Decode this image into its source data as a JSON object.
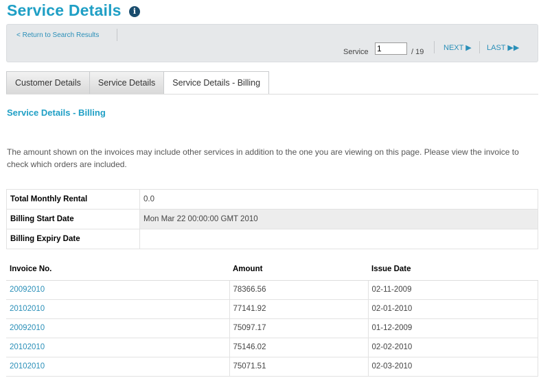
{
  "page": {
    "title": "Service Details",
    "info_icon": "info-icon"
  },
  "toolbar": {
    "return_link": "< Return to Search Results",
    "service_label": "Service",
    "service_value": "1",
    "service_total": "/ 19",
    "next_label": "NEXT ▶",
    "last_label": "LAST ▶▶"
  },
  "tabs": [
    {
      "label": "Customer Details",
      "active": false
    },
    {
      "label": "Service Details",
      "active": false
    },
    {
      "label": "Service Details - Billing",
      "active": true
    }
  ],
  "section": {
    "heading": "Service Details - Billing",
    "notice": "The amount shown on the invoices may include other services in addition to the one you are viewing on this page. Please view the invoice to check which orders are included."
  },
  "summary": [
    {
      "label": "Total Monthly Rental",
      "value": "0.0"
    },
    {
      "label": "Billing Start Date",
      "value": "Mon Mar 22 00:00:00 GMT 2010"
    },
    {
      "label": "Billing Expiry Date",
      "value": ""
    }
  ],
  "invoices": {
    "headers": [
      "Invoice No.",
      "Amount",
      "Issue Date"
    ],
    "rows": [
      {
        "invoice": "20092010",
        "amount": "78366.56",
        "date": "02-11-2009"
      },
      {
        "invoice": "20102010",
        "amount": "77141.92",
        "date": "02-01-2010"
      },
      {
        "invoice": "20092010",
        "amount": "75097.17",
        "date": "01-12-2009"
      },
      {
        "invoice": "20102010",
        "amount": "75146.02",
        "date": "02-02-2010"
      },
      {
        "invoice": "20102010",
        "amount": "75071.51",
        "date": "02-03-2010"
      }
    ]
  },
  "colors": {
    "accent": "#1f9fc5",
    "link": "#2a8fb8",
    "toolbar_bg": "#e6e8ea"
  }
}
